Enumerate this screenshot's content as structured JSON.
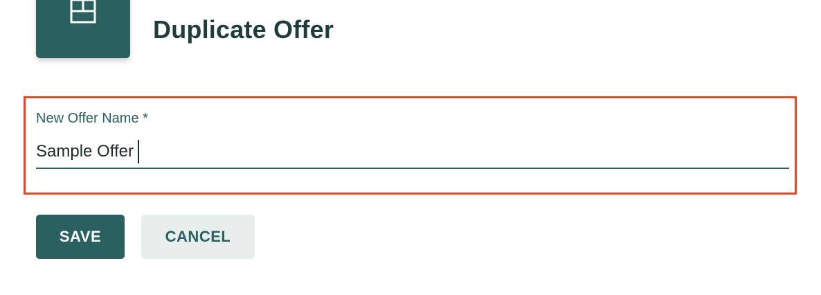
{
  "header": {
    "title": "Duplicate Offer",
    "icon": "duplicate-offer-icon"
  },
  "form": {
    "name_field": {
      "label": "New Offer Name *",
      "value": "Sample Offer"
    }
  },
  "actions": {
    "save_label": "SAVE",
    "cancel_label": "CANCEL"
  },
  "colors": {
    "primary": "#2a6060",
    "title": "#1f3d3b",
    "highlight": "#e5472b",
    "cancel_bg": "#e7eeec"
  }
}
